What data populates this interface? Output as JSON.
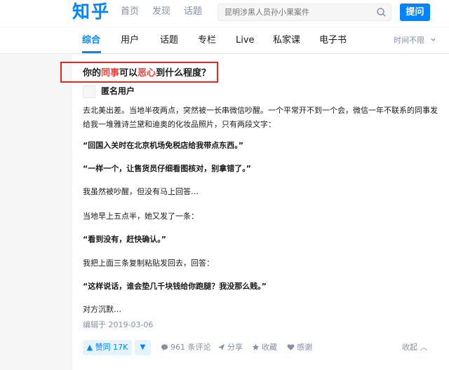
{
  "header": {
    "logo": "知乎",
    "nav": [
      "首页",
      "发现",
      "话题"
    ],
    "search_placeholder": "昆明涉黑人员孙小果案件",
    "ask_label": "提问"
  },
  "tabs": [
    "综合",
    "用户",
    "话题",
    "专栏",
    "Live",
    "私家课",
    "电子书"
  ],
  "time_filter": "时间不限",
  "question": {
    "title_pre": "你的",
    "title_hl1": "同事",
    "title_mid": "可以",
    "title_hl2": "恶心",
    "title_post": "到什么程度？"
  },
  "answer": {
    "author": "匿名用户",
    "paragraphs": [
      "去北美出差。当地半夜两点，突然被一长串微信吵醒。一个平常开不到一个会，微信一年不联系的同事发给我一堆雅诗兰黛和迪奥的化妆品照片，只有两段文字：",
      "“回国入关时在北京机场免税店给我带点东西。”",
      "“一样一个，让售货员仔细看图核对，别拿错了。”",
      "我虽然被吵醒，但没有马上回答…",
      "当地早上五点半，她又发了一条：",
      "“看到没有，赶快确认。”",
      "我把上面三条复制粘贴发回去，回答：",
      "“这样说话，谁会垫几千块钱给你跑腿？我没那么贱。”",
      "对方沉默…"
    ],
    "edited": "编辑于 2019-03-06"
  },
  "actions": {
    "upvote": "▲ 赞同 17K",
    "downvote": "▼",
    "comments": "961 条评论",
    "share": "分享",
    "favorite": "收藏",
    "thanks": "感谢",
    "collapse": "收起 ︿"
  },
  "colors": {
    "brand": "#0084ff",
    "highlight": "#f1403c",
    "annotation_box": "#e0291f"
  }
}
